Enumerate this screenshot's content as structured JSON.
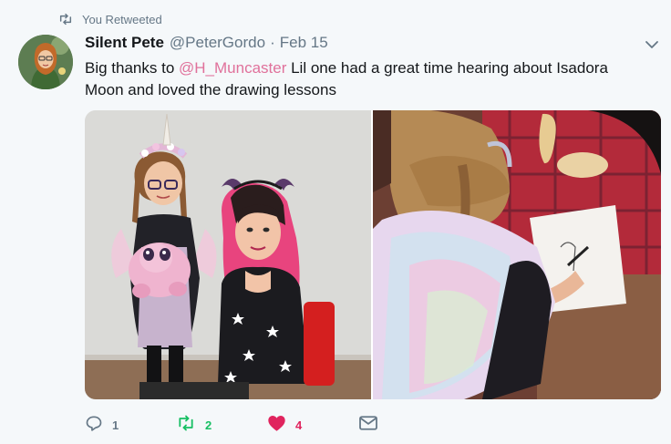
{
  "context": {
    "retweet_label": "You Retweeted"
  },
  "author": {
    "name": "Silent Pete",
    "handle": "@PeterGordo",
    "separator": "·",
    "time": "Feb 15"
  },
  "tweet": {
    "text_before": "Big thanks to ",
    "mention": "@H_Muncaster",
    "text_after": " Lil one had a great time hearing about Isadora Moon and loved the drawing lessons"
  },
  "actions": {
    "reply_count": "1",
    "retweet_count": "2",
    "like_count": "4"
  },
  "colors": {
    "retweeted": "#17bf63",
    "liked": "#e0245e",
    "mention": "#e0719b",
    "muted": "#657786"
  }
}
